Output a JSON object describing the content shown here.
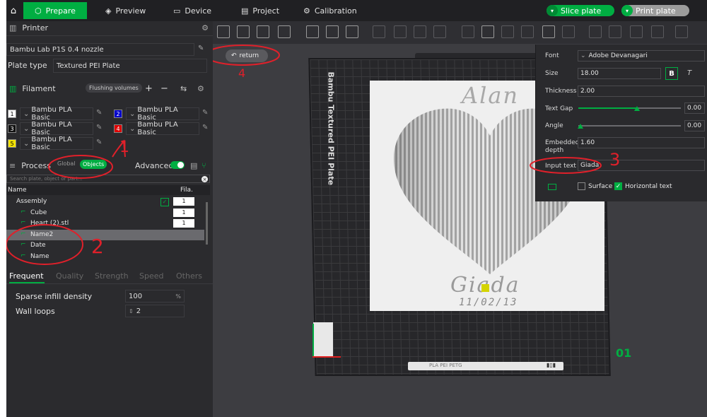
{
  "topbar": {
    "tabs": [
      {
        "label": "Prepare",
        "icon": "cube-icon"
      },
      {
        "label": "Preview",
        "icon": "layers-icon"
      },
      {
        "label": "Device",
        "icon": "monitor-icon"
      },
      {
        "label": "Project",
        "icon": "file-icon"
      },
      {
        "label": "Calibration",
        "icon": "gear-icon"
      }
    ],
    "slice_label": "Slice plate",
    "print_label": "Print plate"
  },
  "printer": {
    "section_title": "Printer",
    "printer_name": "Bambu Lab P1S 0.4 nozzle",
    "plate_type_label": "Plate type",
    "plate_type_value": "Textured PEI Plate"
  },
  "filament": {
    "section_title": "Filament",
    "flushing_label": "Flushing volumes",
    "slots": [
      {
        "num": "1",
        "name": "Bambu PLA Basic",
        "color": "#ffffff",
        "numcolor": "#000000"
      },
      {
        "num": "2",
        "name": "Bambu PLA Basic",
        "color": "#0000cc",
        "numcolor": "#ffffff"
      },
      {
        "num": "3",
        "name": "Bambu PLA Basic",
        "color": "#111111",
        "numcolor": "#ffffff"
      },
      {
        "num": "4",
        "name": "Bambu PLA Basic",
        "color": "#dd0000",
        "numcolor": "#ffffff"
      },
      {
        "num": "5",
        "name": "Bambu PLA Basic",
        "color": "#f5e400",
        "numcolor": "#000000"
      }
    ]
  },
  "process": {
    "section_title": "Process",
    "global_label": "Global",
    "objects_label": "Objects",
    "advanced_label": "Advanced",
    "search_placeholder": "Search plate, object or part...",
    "col_name": "Name",
    "col_fila": "Fila.",
    "tree": [
      {
        "name": "Assembly",
        "fila": "1",
        "level": 0
      },
      {
        "name": "Cube",
        "fila": "1",
        "level": 1
      },
      {
        "name": "Heart (2).stl",
        "fila": "1",
        "level": 1
      },
      {
        "name": "Name2",
        "fila": "",
        "level": 1
      },
      {
        "name": "Date",
        "fila": "",
        "level": 1
      },
      {
        "name": "Name",
        "fila": "",
        "level": 1
      }
    ]
  },
  "settings_tabs": [
    "Frequent",
    "Quality",
    "Strength",
    "Speed",
    "Others"
  ],
  "settings": {
    "sparse_label": "Sparse infill density",
    "sparse_value": "100",
    "sparse_unit": "%",
    "wall_label": "Wall loops",
    "wall_value": "2"
  },
  "viewport": {
    "return_label": "return",
    "plate_brand": "Bambu Textured PEI Plate",
    "plate_number": "01",
    "plate_label_bottom": "PLA PEI PETG",
    "text_alan": "Alan",
    "text_giada": "Giada",
    "text_date": "11/02/13"
  },
  "text_panel": {
    "font_label": "Font",
    "font_value": "Adobe Devanagari",
    "size_label": "Size",
    "size_value": "18.00",
    "bold_label": "B",
    "italic_label": "T",
    "thickness_label": "Thickness",
    "thickness_value": "2.00",
    "textgap_label": "Text Gap",
    "textgap_value": "0.00",
    "textgap_level": 0.57,
    "angle_label": "Angle",
    "angle_value": "0.00",
    "angle_level": 0.0,
    "embedded_label": "Embedded depth",
    "embedded_value": "1.60",
    "input_label": "Input text",
    "input_value": "Giada",
    "surface_label": "Surface",
    "horizontal_label": "Horizontal text"
  },
  "annotations": {
    "a1": "1",
    "a2": "2",
    "a3": "3",
    "a4": "4"
  },
  "colors": {
    "accent": "#00ae42",
    "annotation": "#e0202a"
  }
}
